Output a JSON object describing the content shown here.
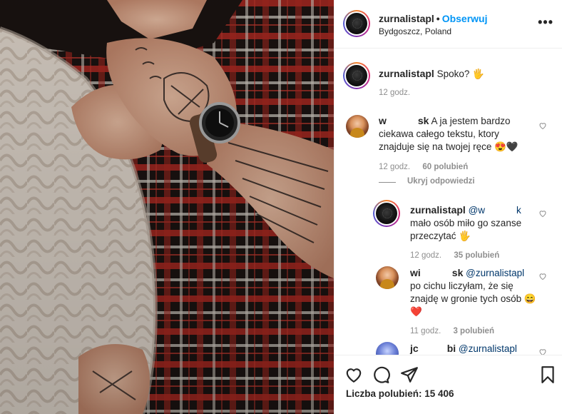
{
  "post": {
    "username": "zurnalistapl",
    "separator": "•",
    "follow_label": "Obserwuj",
    "location": "Bydgoszcz, Poland",
    "more_label": "•••"
  },
  "caption": {
    "username": "zurnalistapl",
    "text": "Spoko? 🖐",
    "time": "12 godz."
  },
  "comments": [
    {
      "username": "w",
      "username_tail": "sk",
      "text": "A ja jestem bardzo ciekawa całego tekstu, ktory znajduje się na twojej ręce 😍🖤",
      "time": "12 godz.",
      "likes": "60 polubień",
      "toggle_replies": "Ukryj odpowiedzi"
    }
  ],
  "replies": [
    {
      "username": "zurnalistapl",
      "mention": "@w",
      "mention_tail": "k",
      "text": "mało osób miło go szanse przeczytać 🖐",
      "time": "12 godz.",
      "likes": "35 polubień"
    },
    {
      "username": "wi",
      "username_tail": "sk",
      "mention": "@zurnalistapl",
      "text": "po cichu liczyłam, że się znajdę w gronie tych osób 😄❤️",
      "time": "11 godz.",
      "likes": "3 polubień"
    },
    {
      "username": "jc",
      "username_tail": "bi",
      "mention": "@zurnalistapl"
    }
  ],
  "footer": {
    "likes_label": "Liczba polubień: 15 406"
  },
  "icons": {
    "like": "heart-icon",
    "comment": "comment-icon",
    "share": "share-icon",
    "save": "bookmark-icon"
  },
  "colors": {
    "accent": "#0095f6",
    "secondary_text": "#8e8e8e",
    "primary_text": "#262626",
    "border": "#efefef"
  }
}
